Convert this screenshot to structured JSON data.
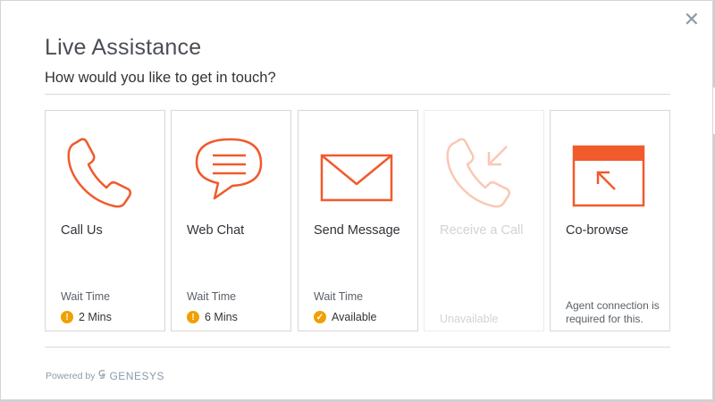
{
  "dialog": {
    "title": "Live Assistance",
    "subtitle": "How would you like to get in touch?",
    "close_symbol": "✕"
  },
  "colors": {
    "accent": "#f15a2b",
    "accent_disabled": "#f9c8b4",
    "warning": "#f0a000"
  },
  "cards": [
    {
      "label": "Call Us",
      "icon": "phone-icon",
      "wait_label": "Wait Time",
      "status": "2 Mins",
      "status_icon": "warning-icon",
      "enabled": true
    },
    {
      "label": "Web Chat",
      "icon": "chat-bubble-icon",
      "wait_label": "Wait Time",
      "status": "6 Mins",
      "status_icon": "warning-icon",
      "enabled": true
    },
    {
      "label": "Send Message",
      "icon": "envelope-icon",
      "wait_label": "Wait Time",
      "status": "Available",
      "status_icon": "check-icon",
      "enabled": true
    },
    {
      "label": "Receive a Call",
      "icon": "incoming-call-icon",
      "status": "Unavailable",
      "enabled": false
    },
    {
      "label": "Co-browse",
      "icon": "browser-window-icon",
      "note": "Agent connection is required for this.",
      "enabled": true
    }
  ],
  "footer": {
    "powered_by": "Powered by",
    "brand": "GENESYS"
  }
}
